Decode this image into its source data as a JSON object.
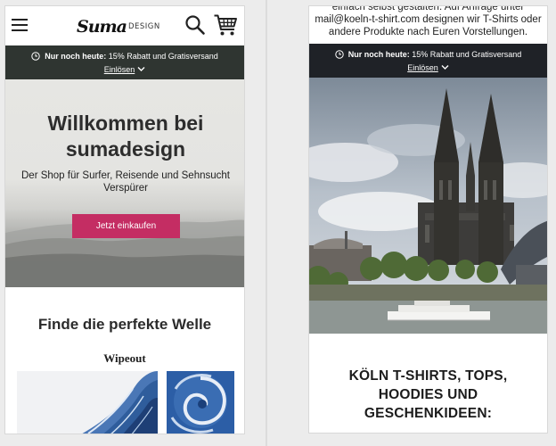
{
  "left_screen": {
    "header": {
      "logo": {
        "script": "Suma",
        "suffix": "DESIGN"
      },
      "icons": [
        "menu-icon",
        "search-icon",
        "cart-icon"
      ]
    },
    "promo": {
      "bold_text": "Nur noch heute:",
      "text": " 15% Rabatt und Gratisversand",
      "redeem_label": "Einlösen"
    },
    "hero": {
      "title": "Willkommen bei sumadesign",
      "subtitle": "Der Shop für Surfer, Reisende und Sehnsucht Verspürer",
      "cta_label": "Jetzt einkaufen"
    },
    "section_title": "Finde die perfekte Welle",
    "product_title": "Wipeout"
  },
  "right_screen": {
    "intro_text": "einfach selbst gestalten. Auf Anfrage unter mail@koeln-t-shirt.com designen wir T-Shirts oder andere Produkte nach Euren Vorstellungen.",
    "promo": {
      "bold_text": "Nur noch heute:",
      "text": " 15% Rabatt und Gratisversand",
      "redeem_label": "Einlösen"
    },
    "heading": "KÖLN T-SHIRTS, TOPS, HOODIES UND GESCHENKIDEEN:"
  },
  "colors": {
    "promo_bar_left": "#2f3531",
    "promo_bar_right": "#1f2227",
    "cta": "#c42d63"
  }
}
